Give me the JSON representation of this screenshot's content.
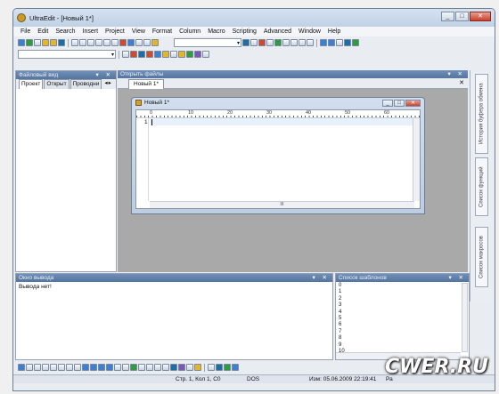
{
  "window": {
    "title": "UltraEdit - [Новый 1*]",
    "controls": [
      "_",
      "□",
      "✕"
    ]
  },
  "menu": [
    "File",
    "Edit",
    "Search",
    "Insert",
    "Project",
    "View",
    "Format",
    "Column",
    "Macro",
    "Scripting",
    "Advanced",
    "Window",
    "Help"
  ],
  "left_panel": {
    "title": "Файловый вид",
    "controls": "▾ ✕",
    "tabs": [
      "Проект",
      "Открыт",
      "Проводни"
    ],
    "tab_arrows": "◂▸"
  },
  "open_files": {
    "title": "Открыть файлы",
    "controls": "▾ ✕",
    "tab": "Новый 1*",
    "tab_close": "✕"
  },
  "editor_window": {
    "title": "Новый 1*",
    "controls": [
      "_",
      "□",
      "✕"
    ],
    "ruler_marks": [
      "0",
      "10",
      "20",
      "30",
      "40",
      "50",
      "60"
    ],
    "line_number": "1",
    "hscroll_label": "III"
  },
  "right_tabs": [
    "История буфера обмена",
    "Список функций",
    "Список макросов"
  ],
  "output": {
    "title": "Окно вывода",
    "controls": "▾ ✕",
    "text": "Вывода нет!"
  },
  "templates": {
    "title": "Список шаблонов",
    "controls": "▾ ✕",
    "items": [
      "0",
      "1",
      "2",
      "3",
      "4",
      "5",
      "6",
      "7",
      "8",
      "9",
      "10"
    ]
  },
  "status": {
    "position": "Стр. 1, Кол 1, C0",
    "format": "DOS",
    "modified": "Изм: 05.06.2009 22:19:41",
    "extra": "Ра"
  },
  "watermark": "CWER.RU"
}
